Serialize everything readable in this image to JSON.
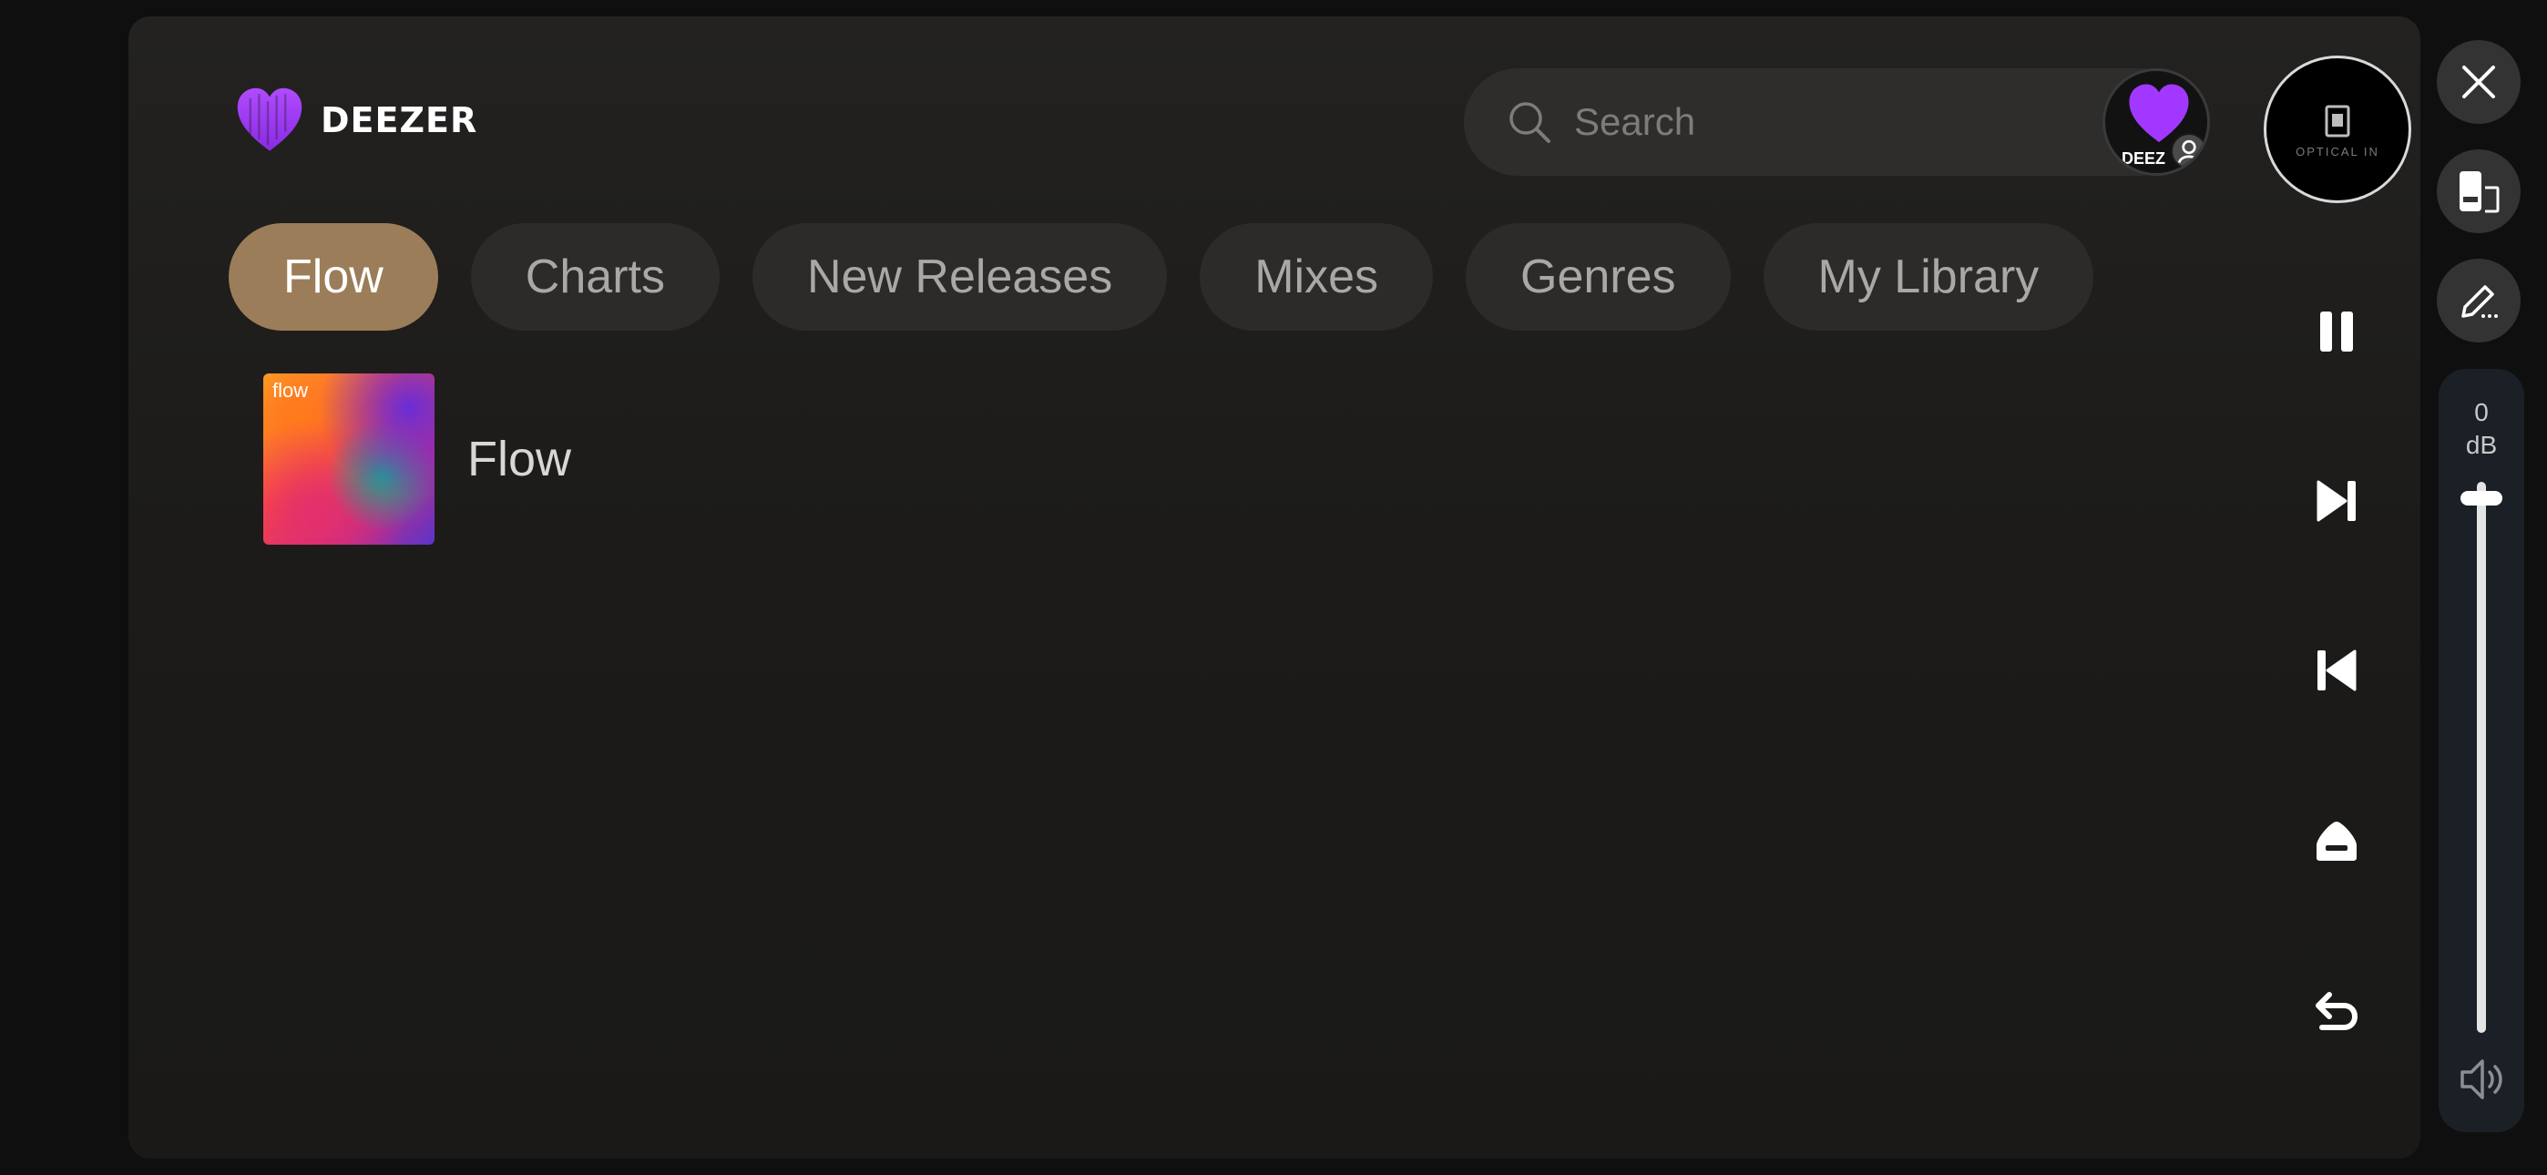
{
  "app": {
    "brand": "DEEZER",
    "accent_color": "#9c7d59",
    "brand_color": "#a238ff"
  },
  "search": {
    "placeholder": "Search"
  },
  "profile": {
    "label": "DEEZ"
  },
  "source": {
    "label": "OPTICAL IN"
  },
  "tabs": [
    {
      "label": "Flow",
      "active": true
    },
    {
      "label": "Charts",
      "active": false
    },
    {
      "label": "New Releases",
      "active": false
    },
    {
      "label": "Mixes",
      "active": false
    },
    {
      "label": "Genres",
      "active": false
    },
    {
      "label": "My Library",
      "active": false
    }
  ],
  "content": {
    "items": [
      {
        "title": "Flow",
        "cover_text": "flow"
      }
    ]
  },
  "controls": {
    "icons": [
      "pause-icon",
      "next-track-icon",
      "previous-track-icon",
      "eject-icon",
      "back-icon"
    ]
  },
  "side": {
    "icons": [
      "close-icon",
      "switch-device-icon",
      "edit-icon"
    ]
  },
  "volume": {
    "value": "0",
    "unit": "dB",
    "level": 0.97
  }
}
